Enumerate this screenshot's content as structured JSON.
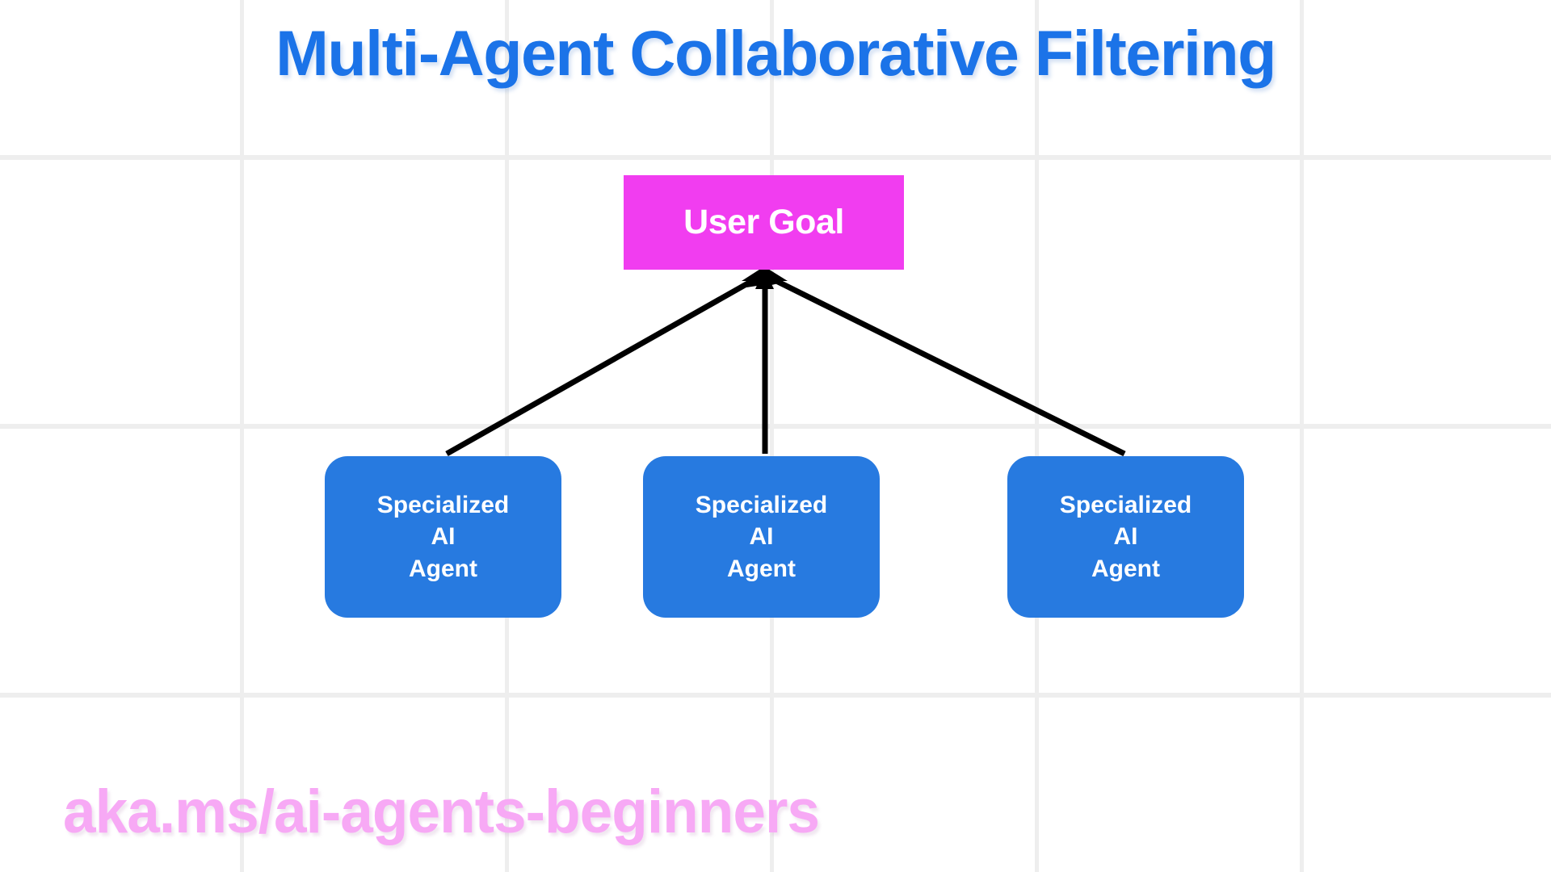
{
  "slide": {
    "title": "Multi-Agent Collaborative Filtering",
    "footer_url": "aka.ms/ai-agents-beginners",
    "background_color": "#ffffff",
    "grid_line_color": "#eeeeee",
    "title_color": "#1b73e8",
    "footer_url_color": "#f7a9f5"
  },
  "diagram": {
    "type": "tree",
    "root": {
      "id": "user-goal",
      "label": "User Goal",
      "shape": "rectangle",
      "fill_color": "#f13df0",
      "text_color": "#ffffff"
    },
    "children": [
      {
        "id": "agent-1",
        "lines": [
          "Specialized",
          "AI",
          "Agent"
        ],
        "shape": "rounded-rectangle",
        "fill_color": "#277ae0",
        "text_color": "#ffffff"
      },
      {
        "id": "agent-2",
        "lines": [
          "Specialized",
          "AI",
          "Agent"
        ],
        "shape": "rounded-rectangle",
        "fill_color": "#277ae0",
        "text_color": "#ffffff"
      },
      {
        "id": "agent-3",
        "lines": [
          "Specialized",
          "AI",
          "Agent"
        ],
        "shape": "rounded-rectangle",
        "fill_color": "#277ae0",
        "text_color": "#ffffff"
      }
    ],
    "edges": [
      {
        "from": "agent-1",
        "to": "user-goal",
        "style": "solid",
        "arrowhead": "at-target",
        "color": "#000000"
      },
      {
        "from": "agent-2",
        "to": "user-goal",
        "style": "solid",
        "arrowhead": "at-target",
        "color": "#000000"
      },
      {
        "from": "agent-3",
        "to": "user-goal",
        "style": "solid",
        "arrowhead": "at-target",
        "color": "#000000"
      }
    ]
  }
}
